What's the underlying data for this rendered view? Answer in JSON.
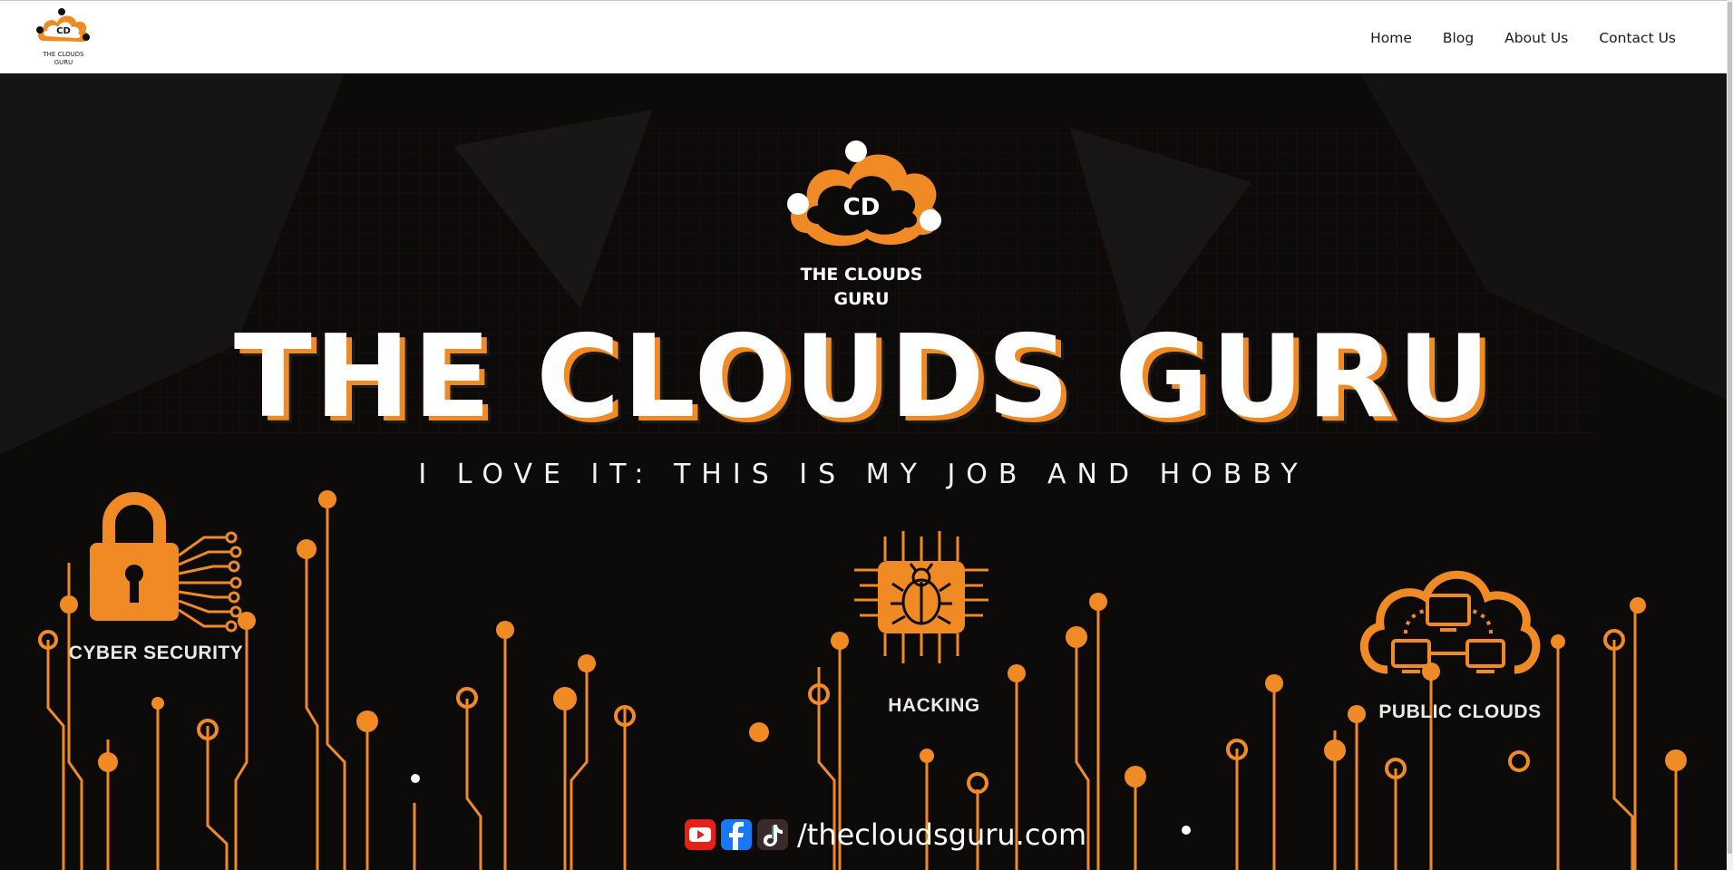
{
  "header": {
    "logo_text_line1": "THE CLOUDS",
    "logo_text_line2": "GURU",
    "nav": [
      {
        "label": "Home"
      },
      {
        "label": "Blog"
      },
      {
        "label": "About Us"
      },
      {
        "label": "Contact Us"
      }
    ]
  },
  "hero": {
    "logo_text_line1": "THE CLOUDS",
    "logo_text_line2": "GURU",
    "title": "THE CLOUDS GURU",
    "subtitle": "I LOVE IT: THIS IS MY JOB AND HOBBY",
    "features": [
      {
        "label": "CYBER SECURITY",
        "icon": "padlock-circuit-icon"
      },
      {
        "label": "HACKING",
        "icon": "bug-chip-icon"
      },
      {
        "label": "PUBLIC CLOUDS",
        "icon": "cloud-network-icon"
      }
    ],
    "social": {
      "icons": [
        "youtube-icon",
        "facebook-icon",
        "tiktok-icon"
      ],
      "handle": "/thecloudsguru.com"
    }
  },
  "colors": {
    "accent": "#f08a24",
    "background": "#0d0b0a",
    "nav_background": "#ffffff",
    "youtube": "#e62117",
    "facebook": "#1877f2"
  }
}
